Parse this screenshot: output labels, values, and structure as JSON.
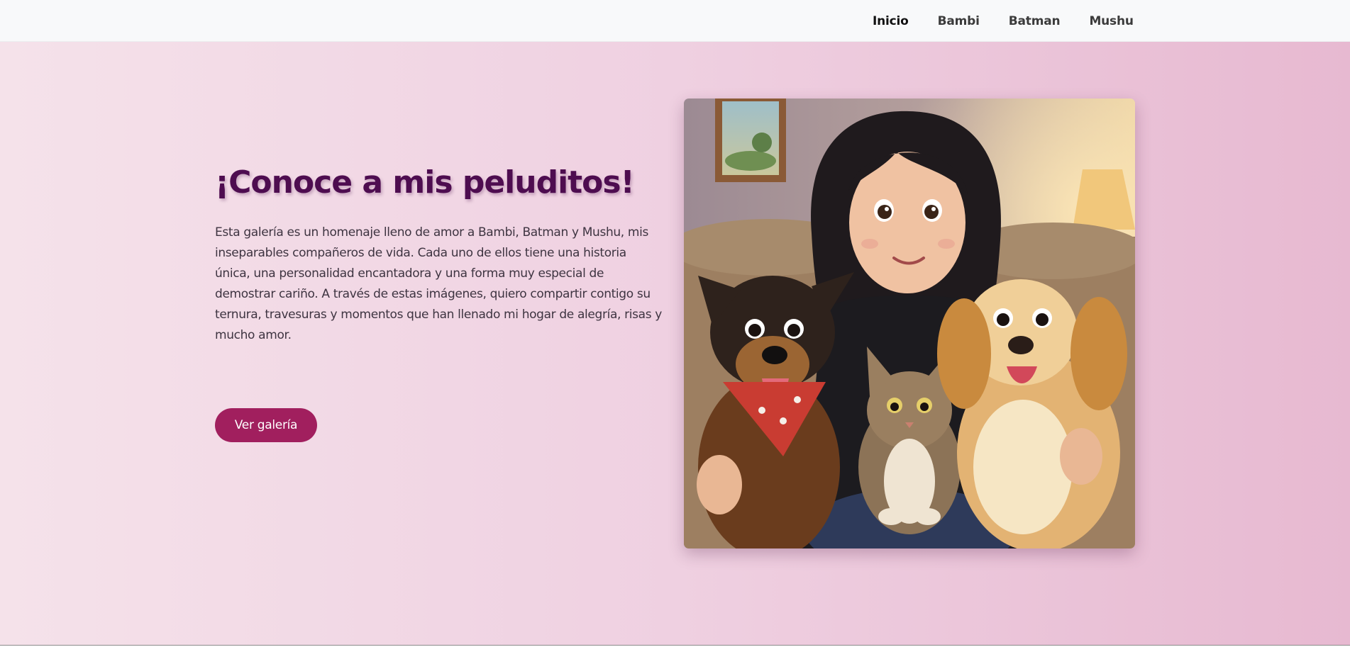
{
  "nav": {
    "links": [
      {
        "label": "Inicio",
        "active": true
      },
      {
        "label": "Bambi",
        "active": false
      },
      {
        "label": "Batman",
        "active": false
      },
      {
        "label": "Mushu",
        "active": false
      }
    ]
  },
  "hero": {
    "title": "¡Conoce a mis peluditos!",
    "description": "Esta galería es un homenaje lleno de amor a Bambi, Batman y Mushu, mis inseparables compañeros de vida. Cada uno de ellos tiene una historia única, una personalidad encantadora y una forma muy especial de demostrar cariño. A través de estas imágenes, quiero compartir contigo su ternura, travesuras y momentos que han llenado mi hogar de alegría, risas y mucho amor.",
    "button_label": "Ver galería",
    "image_description": "Ilustración de una chica con dos perros y un gato en un sofá"
  },
  "colors": {
    "accent": "#a11f5e",
    "title": "#4e0d50",
    "navbar_bg": "#f8f9fa"
  }
}
